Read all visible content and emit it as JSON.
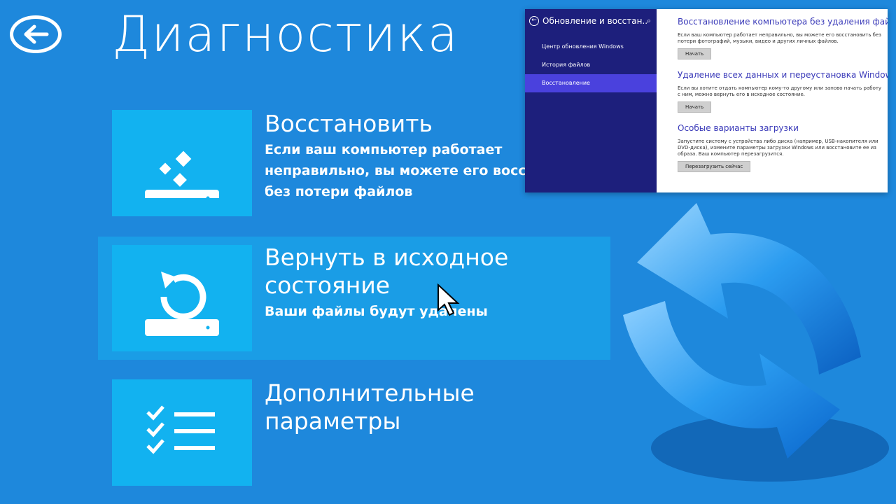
{
  "page_title": "Диагностика",
  "options": [
    {
      "title": "Восстановить",
      "desc": "Если ваш компьютер работает неправильно, вы можете его восстановить без потери файлов"
    },
    {
      "title": "Вернуть в исходное состояние",
      "desc": "Ваши файлы будут удалены"
    },
    {
      "title": "Дополнительные параметры",
      "desc": ""
    }
  ],
  "settings": {
    "header_title": "Обновление и восстан...",
    "nav": [
      "Центр обновления Windows",
      "История файлов",
      "Восстановление"
    ],
    "sections": [
      {
        "title": "Восстановление компьютера без удаления файлов",
        "desc": "Если ваш компьютер работает неправильно, вы можете его восстановить без потери фотографий, музыки, видео и других личных файлов.",
        "button": "Начать"
      },
      {
        "title": "Удаление всех данных и переустановка Windows",
        "desc": "Если вы хотите отдать компьютер кому-то другому или заново начать работу с ним, можно вернуть его в исходное состояние.",
        "button": "Начать"
      },
      {
        "title": "Особые варианты загрузки",
        "desc": "Запустите систему с устройства либо диска (например, USB-накопителя или DVD-диска), измените параметры загрузки Windows или восстановите ее из образа. Ваш компьютер перезагрузится.",
        "button": "Перезагрузить сейчас"
      }
    ]
  },
  "colors": {
    "background": "#1e88dc",
    "tile": "#12b2f0",
    "selected_row": "#1a9de6",
    "settings_sidebar": "#1d1f7c",
    "settings_active": "#4a41dd",
    "settings_heading": "#3b3bb9"
  },
  "icons": [
    "back-arrow-icon",
    "refresh-sparkle-icon",
    "reset-icon",
    "checklist-icon",
    "search-icon",
    "refresh-arrows-icon",
    "mouse-pointer-icon"
  ]
}
